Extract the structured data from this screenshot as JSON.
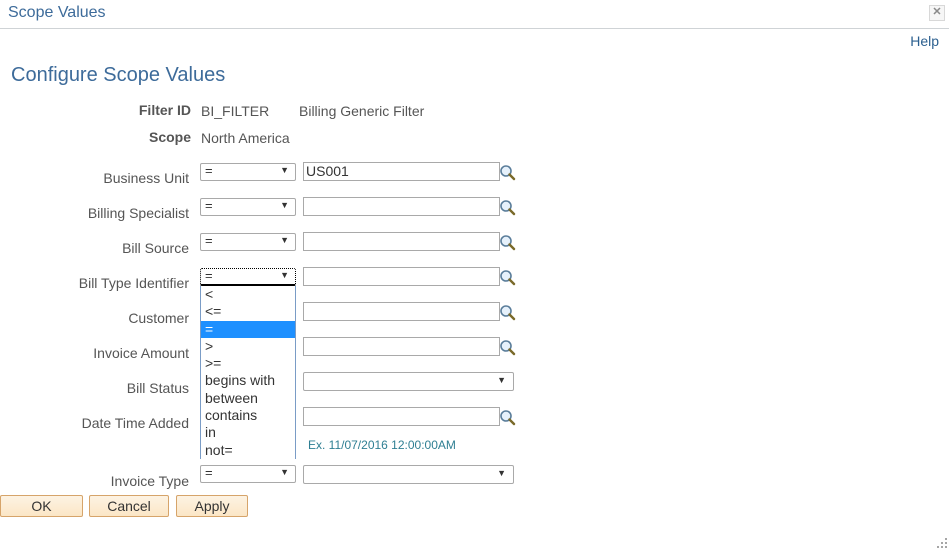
{
  "window": {
    "title": "Scope Values",
    "close_icon": "close-x-icon",
    "help_label": "Help"
  },
  "page": {
    "title": "Configure Scope Values"
  },
  "info": {
    "filter_id_label": "Filter ID",
    "filter_id_value": "BI_FILTER",
    "filter_description": "Billing Generic Filter",
    "scope_label": "Scope",
    "scope_value": "North America"
  },
  "fields": [
    {
      "label": "Business Unit",
      "operator": "=",
      "value": "US001",
      "control": "input-lookup"
    },
    {
      "label": "Billing Specialist",
      "operator": "=",
      "value": "",
      "control": "input-lookup"
    },
    {
      "label": "Bill Source",
      "operator": "=",
      "value": "",
      "control": "input-lookup"
    },
    {
      "label": "Bill Type Identifier",
      "operator": "=",
      "value": "",
      "control": "input-lookup",
      "dropdown_open": true
    },
    {
      "label": "Customer",
      "operator": "",
      "value": "",
      "control": "input-lookup"
    },
    {
      "label": "Invoice Amount",
      "operator": "",
      "value": "",
      "control": "input-lookup"
    },
    {
      "label": "Bill Status",
      "operator": "",
      "value": "",
      "control": "select"
    },
    {
      "label": "Date Time Added",
      "operator": "",
      "value": "",
      "control": "input-lookup",
      "hint": "Ex. 11/07/2016 12:00:00AM"
    },
    {
      "label": "Invoice Type",
      "operator": "=",
      "value": "",
      "control": "select"
    }
  ],
  "operator_dropdown": {
    "options": [
      "<",
      "<=",
      "=",
      ">",
      ">=",
      "begins with",
      "between",
      "contains",
      "in",
      "not="
    ],
    "selected": "=",
    "highlight_color": "#1e90ff"
  },
  "buttons": {
    "ok": "OK",
    "cancel": "Cancel",
    "apply": "Apply"
  },
  "icons": {
    "lookup": "magnifier-lookup-icon",
    "dropdown_arrow": "▼",
    "resize": "resize-grip-icon"
  },
  "colors": {
    "title": "#3d6b9a",
    "link": "#2b5f8f",
    "hint": "#2f7f93",
    "button_bg": "#fbe6c6",
    "button_border": "#d6a46a"
  }
}
